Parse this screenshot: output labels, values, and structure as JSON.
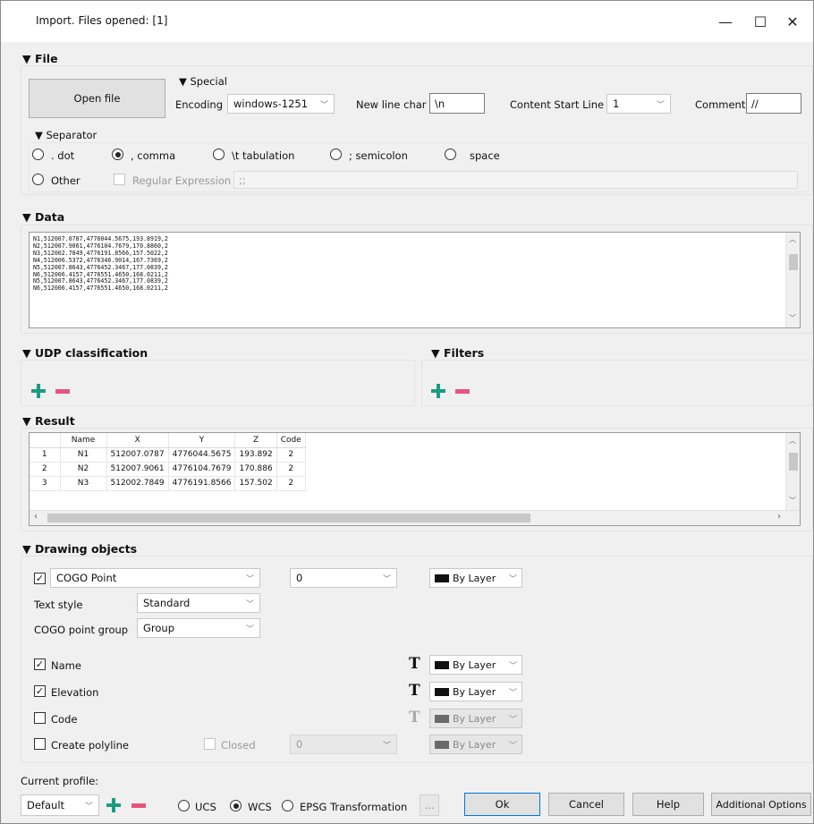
{
  "window": {
    "title": "Import. Files opened: [1]",
    "minimize_glyph": "—",
    "maximize_glyph": "☐",
    "close_glyph": "✕"
  },
  "file": {
    "header": "▼ File",
    "open_button": "Open file",
    "special_header": "▼ Special",
    "encoding_label": "Encoding",
    "encoding_value": "windows-1251",
    "newline_label": "New line char",
    "newline_value": "\\n",
    "content_start_label": "Content Start Line",
    "content_start_value": "1",
    "comment_label": "Comment",
    "comment_value": "//"
  },
  "separator": {
    "header": "▼ Separator",
    "options": [
      ". dot",
      ", comma",
      "\\t tabulation",
      "; semicolon",
      "space"
    ],
    "selected_index": 1,
    "other_label": "Other",
    "regex_label": "Regular Expression",
    "regex_value": ";;"
  },
  "data": {
    "header": "▼ Data",
    "lines": "N1,512007.0787,4776044.5675,193.8919,2\nN2,512007.9061,4776104.7679,170.8860,2\nN3,512002.7849,4776191.8566,157.5022,2\nN4,512006.5372,4776346.9014,167.7369,2\nN5,512007.8643,4776452.3467,177.0839,2\nN6,512006.4157,4776551.4650,168.0211,2\nN5,512007.8643,4776452.3467,177.0839,2\nN6,512006.4157,4776551.4650,168.0211,2"
  },
  "udp": {
    "header": "▼ UDP classification"
  },
  "filters": {
    "header": "▼ Filters"
  },
  "result": {
    "header": "▼ Result",
    "columns": [
      "",
      "Name",
      "X",
      "Y",
      "Z",
      "Code"
    ],
    "rows": [
      [
        "1",
        "N1",
        "512007.0787",
        "4776044.5675",
        "193.892",
        "2"
      ],
      [
        "2",
        "N2",
        "512007.9061",
        "4776104.7679",
        "170.886",
        "2"
      ],
      [
        "3",
        "N3",
        "512002.7849",
        "4776191.8566",
        "157.502",
        "2"
      ]
    ]
  },
  "drawing": {
    "header": "▼ Drawing objects",
    "cogo_label": "COGO Point",
    "layer_value": "0",
    "by_layer": "By Layer",
    "text_style_label": "Text style",
    "text_style_value": "Standard",
    "cogo_group_label": "COGO point group",
    "cogo_group_value": "Group",
    "name_label": "Name",
    "elevation_label": "Elevation",
    "code_label": "Code",
    "polyline_label": "Create polyline",
    "closed_label": "Closed",
    "polyline_layer_value": "0",
    "t_glyph": "T"
  },
  "footer": {
    "profile_label": "Current profile:",
    "profile_value": "Default",
    "ucs_label": "UCS",
    "wcs_label": "WCS",
    "epsg_label": "EPSG Transformation",
    "epsg_button": "...",
    "ok": "Ok",
    "cancel": "Cancel",
    "help": "Help",
    "additional": "Additional Options"
  }
}
